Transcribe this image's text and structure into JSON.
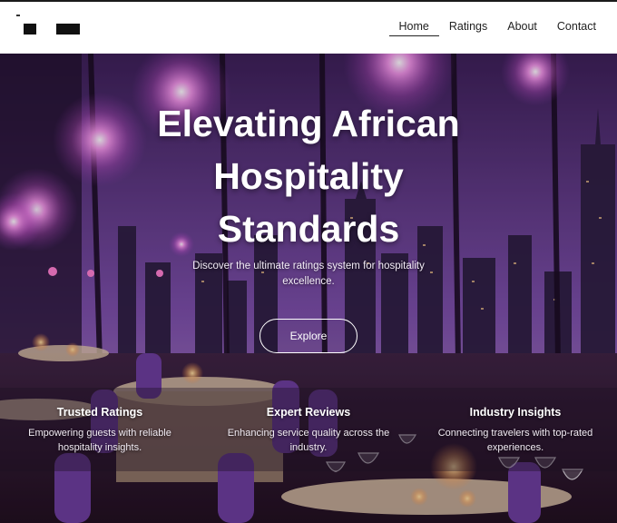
{
  "header": {
    "nav": [
      {
        "label": "Home",
        "active": true
      },
      {
        "label": "Ratings",
        "active": false
      },
      {
        "label": "About",
        "active": false
      },
      {
        "label": "Contact",
        "active": false
      }
    ]
  },
  "hero": {
    "title_lines": [
      "Elevating African",
      "Hospitality",
      "Standards"
    ],
    "subtitle": "Discover the ultimate ratings system for hospitality excellence.",
    "cta_label": "Explore",
    "background_image": "restaurant-city-skyline-fireworks-image"
  },
  "features": [
    {
      "title": "Trusted Ratings",
      "description": "Empowering guests with reliable hospitality insights."
    },
    {
      "title": "Expert Reviews",
      "description": "Enhancing service quality across the industry."
    },
    {
      "title": "Industry Insights",
      "description": "Connecting travelers with top-rated experiences."
    }
  ],
  "colors": {
    "header_bg": "#ffffff",
    "hero_purple": "#5a3682",
    "text_light": "#ffffff"
  }
}
